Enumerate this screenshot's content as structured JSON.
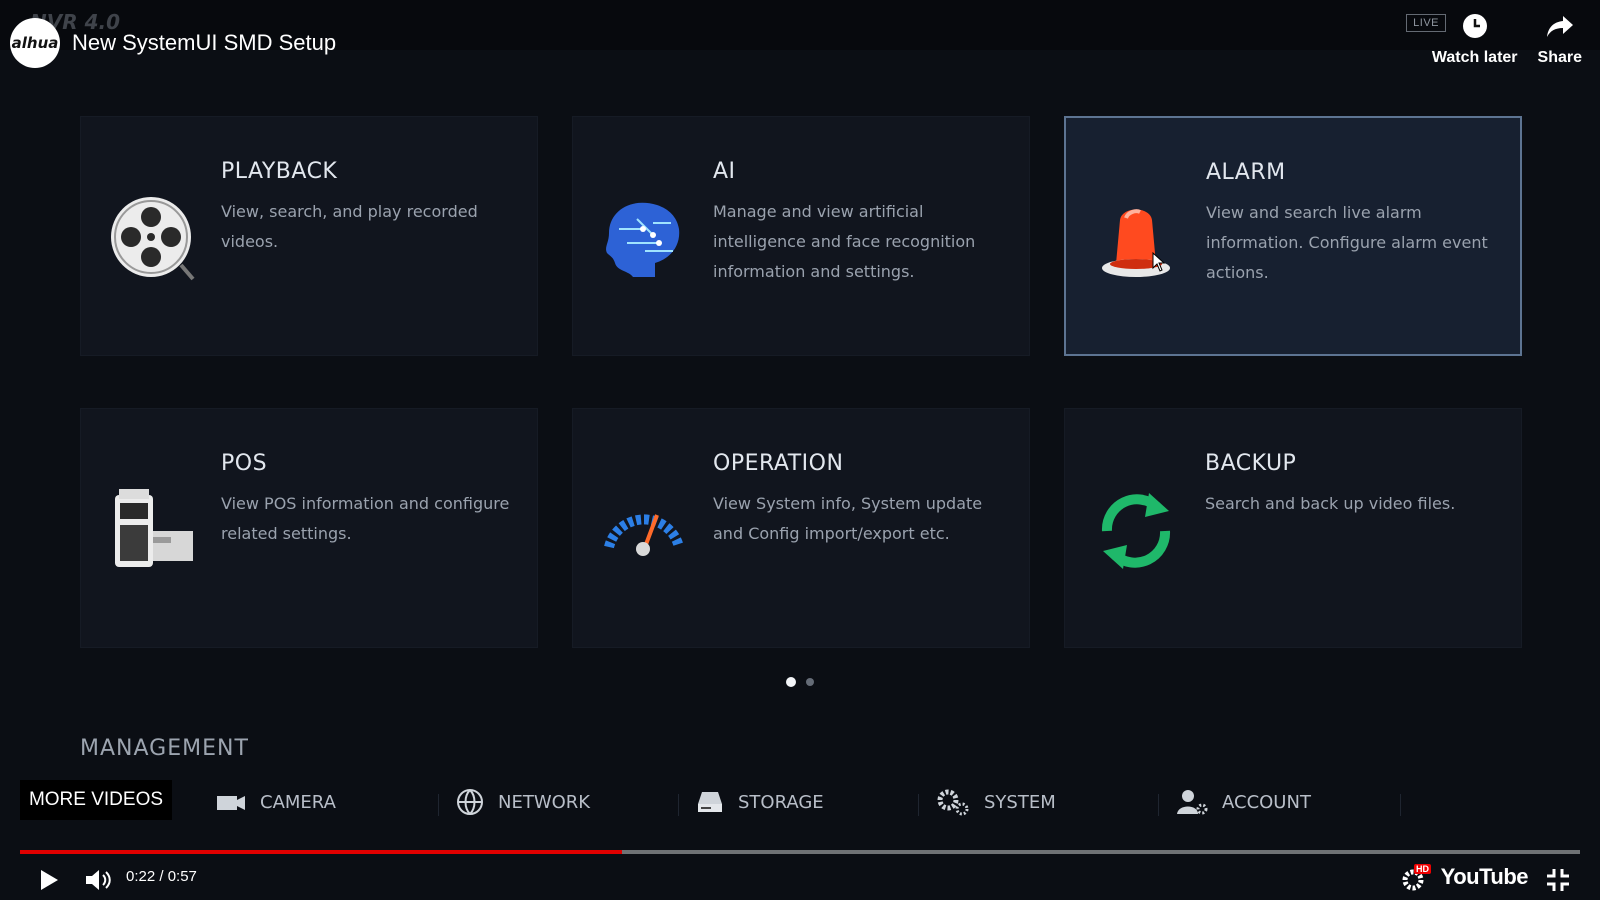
{
  "video": {
    "channel_logo_text": "alhua",
    "title": "New SystemUI SMD Setup",
    "live_badge": "LIVE",
    "watch_later": "Watch later",
    "share": "Share"
  },
  "cards": [
    {
      "title": "PLAYBACK",
      "desc": "View, search, and play recorded videos.",
      "icon": "film-reel-icon"
    },
    {
      "title": "AI",
      "desc": "Manage and view artificial intelligence and face recognition information and settings.",
      "icon": "ai-brain-icon"
    },
    {
      "title": "ALARM",
      "desc": "View and search live alarm information. Configure alarm event actions.",
      "icon": "alarm-beacon-icon",
      "active": true
    },
    {
      "title": "POS",
      "desc": "View POS information and configure related settings.",
      "icon": "pos-terminal-icon"
    },
    {
      "title": "OPERATION",
      "desc": "View System info, System update and Config import/export etc.",
      "icon": "gauge-icon"
    },
    {
      "title": "BACKUP",
      "desc": "Search and back up video files.",
      "icon": "sync-arrows-icon"
    }
  ],
  "pager": {
    "pages": 2,
    "current": 1
  },
  "management": {
    "heading": "MANAGEMENT",
    "items": [
      {
        "label": "CAMERA",
        "icon": "camera-icon"
      },
      {
        "label": "NETWORK",
        "icon": "globe-icon"
      },
      {
        "label": "STORAGE",
        "icon": "hard-drive-icon"
      },
      {
        "label": "SYSTEM",
        "icon": "gears-icon"
      },
      {
        "label": "ACCOUNT",
        "icon": "user-gear-icon"
      }
    ]
  },
  "player": {
    "more_videos": "MORE VIDEOS",
    "time": "0:22 / 0:57",
    "progress_fraction": 0.386,
    "youtube_logo": "YouTube",
    "hd_badge": "HD"
  },
  "colors": {
    "accent_red": "#e00000",
    "card_bg": "#11151e",
    "active_border": "#5d7492"
  }
}
